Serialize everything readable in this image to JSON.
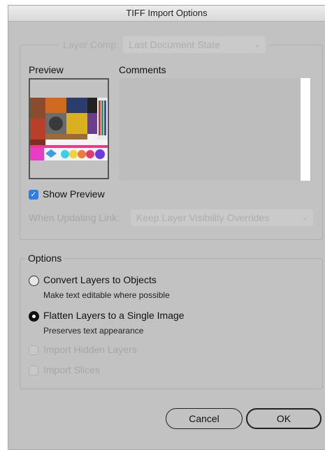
{
  "window": {
    "title": "TIFF Import Options"
  },
  "layer_comp": {
    "label": "Layer Comp:",
    "value": "Last Document State"
  },
  "preview": {
    "label": "Preview"
  },
  "comments": {
    "label": "Comments"
  },
  "show_preview": {
    "label": "Show Preview",
    "checked": true
  },
  "when_updating": {
    "label": "When Updating Link:",
    "value": "Keep Layer Visibility Overrides"
  },
  "options": {
    "heading": "Options",
    "convert": {
      "label": "Convert Layers to Objects",
      "desc": "Make text editable where possible",
      "selected": false
    },
    "flatten": {
      "label": "Flatten Layers to a Single Image",
      "desc": "Preserves text appearance",
      "selected": true
    },
    "hidden_layers": {
      "label": "Import Hidden Layers",
      "checked": false
    },
    "slices": {
      "label": "Import Slices",
      "checked": false
    }
  },
  "buttons": {
    "cancel": "Cancel",
    "ok": "OK"
  },
  "icons": {
    "checkmark": "✓",
    "chevron": "⌄"
  }
}
